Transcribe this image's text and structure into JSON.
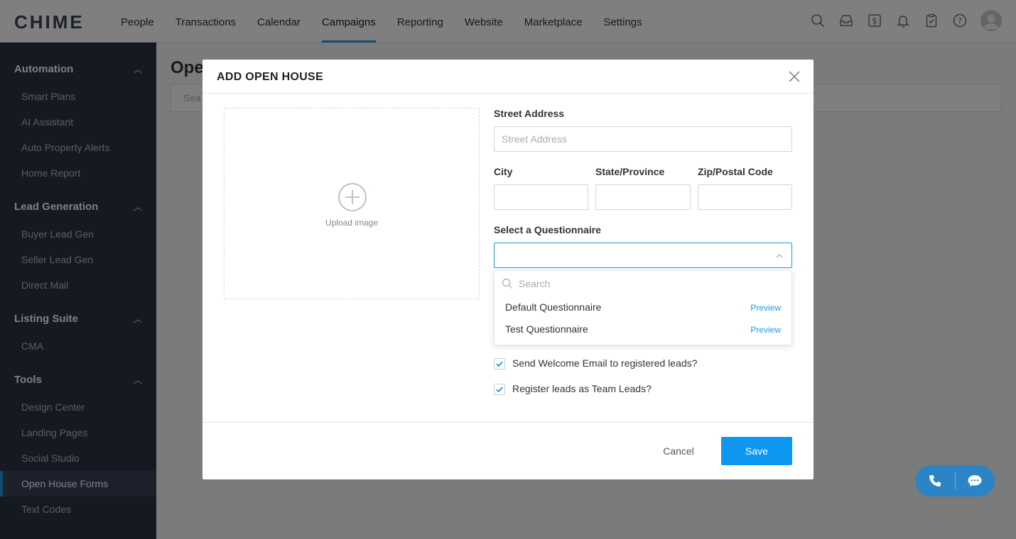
{
  "brand": {
    "logo": "CHIME",
    "accent": "#1a9bdc",
    "sidebar_bg": "#2a3245",
    "save_bg": "#0e97f0"
  },
  "topnav": {
    "items": [
      "People",
      "Transactions",
      "Calendar",
      "Campaigns",
      "Reporting",
      "Website",
      "Marketplace",
      "Settings"
    ],
    "active": "Campaigns",
    "icons": [
      "search-icon",
      "inbox-icon",
      "dollar-icon",
      "bell-icon",
      "clipboard-icon",
      "help-icon"
    ]
  },
  "sidebar": {
    "sections": [
      {
        "title": "Automation",
        "items": [
          "Smart Plans",
          "AI Assistant",
          "Auto Property Alerts",
          "Home Report"
        ]
      },
      {
        "title": "Lead Generation",
        "items": [
          "Buyer Lead Gen",
          "Seller Lead Gen",
          "Direct Mail"
        ]
      },
      {
        "title": "Listing Suite",
        "items": [
          "CMA"
        ]
      },
      {
        "title": "Tools",
        "items": [
          "Design Center",
          "Landing Pages",
          "Social Studio",
          "Open House Forms",
          "Text Codes"
        ]
      }
    ],
    "active_item": "Open House Forms"
  },
  "main": {
    "title": "Ope",
    "search_placeholder": "Sea"
  },
  "modal": {
    "title": "ADD OPEN HOUSE",
    "upload_label": "Upload image",
    "street_label": "Street Address",
    "street_placeholder": "Street Address",
    "city_label": "City",
    "state_label": "State/Province",
    "zip_label": "Zip/Postal Code",
    "questionnaire_label": "Select a Questionnaire",
    "dropdown": {
      "search_placeholder": "Search",
      "options": [
        {
          "label": "Default Questionnaire",
          "action": "Preview"
        },
        {
          "label": "Test Questionnaire",
          "action": "Preview"
        }
      ]
    },
    "checkboxes": [
      {
        "label": "Send Welcome Email to registered leads?",
        "checked": true
      },
      {
        "label": "Register leads as Team Leads?",
        "checked": true
      }
    ],
    "cancel_label": "Cancel",
    "save_label": "Save"
  }
}
